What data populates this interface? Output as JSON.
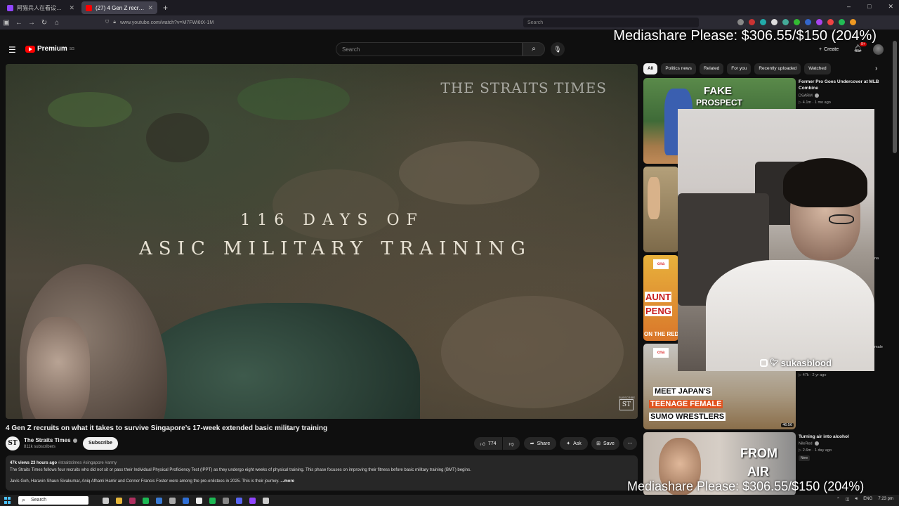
{
  "browser": {
    "tabs": [
      {
        "title": "阿猫兵人在看设片 - Twitch",
        "active": false,
        "favicon_color": "#9146ff"
      },
      {
        "title": "(27) 4 Gen Z recruits on wh...",
        "active": true,
        "favicon_color": "#ff0000"
      }
    ],
    "new_tab": "+",
    "url": "www.youtube.com/watch?v=M7FWi6tX-1M",
    "search_placeholder": "Search",
    "window_controls": [
      "–",
      "□",
      "✕"
    ]
  },
  "youtube_header": {
    "logo_text": "Premium",
    "logo_region": "SG",
    "search_placeholder": "Search",
    "create_label": "Create",
    "notification_count": "9+"
  },
  "overlays": {
    "top": "Mediashare Please: $306.55/$150 (204%)",
    "bottom": "Mediashare Please: $306.55/$150 (204%)"
  },
  "video": {
    "watermark": "THE STRAITS TIMES",
    "title_line1": "116 DAYS OF",
    "title_line2": "ASIC MILITARY TRAINING",
    "corner_badge": "ST",
    "corner_badge_sub": "SUBSCRIBE",
    "title": "4 Gen Z recruits on what it takes to survive Singapore’s 17-week extended basic military training",
    "channel_avatar": "ST",
    "channel_name": "The Straits Times",
    "subscribers": "811k subscribers",
    "subscribe_label": "Subscribe",
    "likes": "774",
    "share_label": "Share",
    "ask_label": "Ask",
    "save_label": "Save",
    "more_label": "⋯",
    "description": {
      "views": "47k views",
      "age": "23 hours ago",
      "tags": "#straitstimes #singapore #army",
      "line1": "The Straits Times follows four recruits who did not sit or pass their Individual Physical Proficiency Test (IPPT) as they undergo eight weeks of physical training. This phase focuses on improving their fitness before basic military training (BMT) begins.",
      "line2": "Javis Goh, Haravin Shaun Sivakumar, Aniq Afhami Hamir and Connor Francis Foster were among the pre-enlistees in 2025. This is their journey.",
      "more": "...more"
    }
  },
  "sidebar": {
    "chips": [
      "All",
      "Politics news",
      "Related",
      "For you",
      "Recently uploaded",
      "Watched"
    ],
    "recommendations": [
      {
        "title": "Former Pro Goes Undercover at MLB Combine",
        "channel": "DSARM",
        "stats": "4.1m · 1 mo ago",
        "thumb_text": [
          "FAKE",
          "PROSPECT"
        ]
      },
      {
        "title": "",
        "channel": "",
        "stats": "",
        "thumb_text": []
      },
      {
        "title": "",
        "channel": "",
        "stats": "",
        "thumb_text": [
          "AUNT",
          "PENG",
          "ON THE RED"
        ]
      },
      {
        "title": "",
        "channel": "",
        "stats": "47k · 2 yr ago",
        "thumb_text": [
          "MEET JAPAN'S",
          "TEENAGE FEMALE",
          "SUMO WRESTLERS"
        ],
        "duration": "46:56"
      },
      {
        "title": "Turning air into alcohol",
        "channel": "NileRed",
        "stats": "2.6m · 1 day ago",
        "badge": "New",
        "thumb_text": [
          "FROM",
          "AIR"
        ]
      }
    ],
    "partial_text": [
      "na",
      "male"
    ]
  },
  "webcam": {
    "social": "sukasblood"
  },
  "taskbar": {
    "search_placeholder": "Search",
    "tray_lang": "ENG",
    "time": "7:23 pm"
  }
}
